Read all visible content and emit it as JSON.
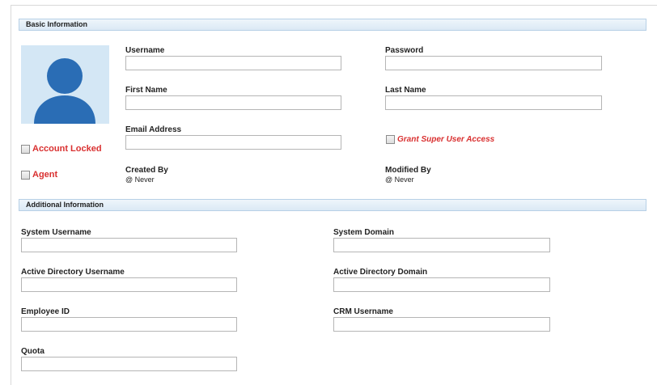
{
  "basic": {
    "title": "Basic Information",
    "username_label": "Username",
    "username_value": "",
    "password_label": "Password",
    "password_value": "",
    "first_name_label": "First Name",
    "first_name_value": "",
    "last_name_label": "Last Name",
    "last_name_value": "",
    "email_label": "Email Address",
    "email_value": "",
    "account_locked_label": "Account Locked",
    "agent_label": "Agent",
    "grant_super_label": "Grant Super User Access",
    "created_by_label": "Created By",
    "created_by_value": "@ Never",
    "modified_by_label": "Modified By",
    "modified_by_value": "@ Never"
  },
  "additional": {
    "title": "Additional Information",
    "system_username_label": "System Username",
    "system_username_value": "",
    "system_domain_label": "System Domain",
    "system_domain_value": "",
    "ad_username_label": "Active Directory Username",
    "ad_username_value": "",
    "ad_domain_label": "Active Directory Domain",
    "ad_domain_value": "",
    "employee_id_label": "Employee ID",
    "employee_id_value": "",
    "crm_username_label": "CRM Username",
    "crm_username_value": "",
    "quota_label": "Quota",
    "quota_value": ""
  },
  "colors": {
    "header_bg": "#dbe9f5",
    "avatar_bg": "#d4e7f5",
    "avatar_figure": "#2a6db5",
    "alert_red": "#d93030"
  },
  "icons": {
    "avatar": "user-silhouette-icon",
    "checkbox": "checkbox-icon"
  }
}
